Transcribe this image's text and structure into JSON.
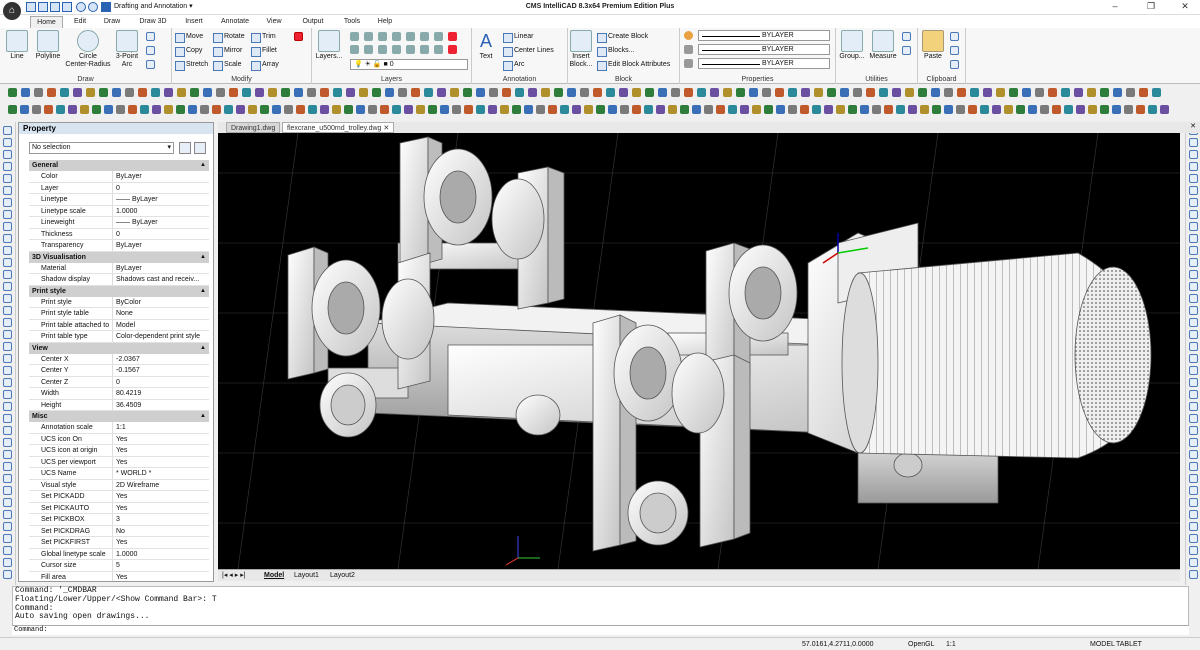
{
  "app": {
    "title": "CMS IntelliCAD 8.3x64 Premium Edition Plus",
    "workspace": "Drafting and Annotation"
  },
  "ribbon_tabs": [
    "Home",
    "Edit",
    "Draw",
    "Draw 3D",
    "Insert",
    "Annotate",
    "View",
    "Output",
    "Tools",
    "Help"
  ],
  "ribbon": {
    "draw": {
      "label": "Draw",
      "line": "Line",
      "polyline": "Polyline",
      "circle": "Circle",
      "circle_sub": "Center-Radius",
      "arc": "3-Point",
      "arc_sub": "Arc"
    },
    "modify": {
      "label": "Modify",
      "move": "Move",
      "rotate": "Rotate",
      "trim": "Trim",
      "copy": "Copy",
      "mirror": "Mirror",
      "fillet": "Fillet",
      "stretch": "Stretch",
      "scale": "Scale",
      "array": "Array"
    },
    "layers": {
      "label": "Layers",
      "button": "Layers...",
      "current": "0"
    },
    "annotation": {
      "label": "Annotation",
      "text": "Text",
      "linear": "Linear",
      "centerlines": "Center Lines",
      "arc": "Arc"
    },
    "block": {
      "label": "Block",
      "insert": "Insert",
      "insert_sub": "Block...",
      "create": "Create Block",
      "blocks": "Blocks...",
      "edit_attr": "Edit Block Attributes"
    },
    "properties": {
      "label": "Properties",
      "color": "BYLAYER",
      "linetype": "BYLAYER",
      "lineweight": "BYLAYER"
    },
    "utilities": {
      "label": "Utilities",
      "group": "Group...",
      "measure": "Measure"
    },
    "clipboard": {
      "label": "Clipboard",
      "paste": "Paste"
    }
  },
  "doc_tabs": [
    "Drawing1.dwg",
    "flexcrane_u500md_trolley.dwg"
  ],
  "property": {
    "title": "Property",
    "selection": "No selection",
    "sections": [
      {
        "name": "General",
        "rows": [
          [
            "Color",
            "ByLayer"
          ],
          [
            "Layer",
            "0"
          ],
          [
            "Linetype",
            "—— ByLayer"
          ],
          [
            "Linetype scale",
            "1.0000"
          ],
          [
            "Lineweight",
            "—— ByLayer"
          ],
          [
            "Thickness",
            "0"
          ],
          [
            "Transparency",
            "ByLayer"
          ]
        ]
      },
      {
        "name": "3D Visualisation",
        "rows": [
          [
            "Material",
            "ByLayer"
          ],
          [
            "Shadow display",
            "Shadows cast and receiv..."
          ]
        ]
      },
      {
        "name": "Print style",
        "rows": [
          [
            "Print style",
            "ByColor"
          ],
          [
            "Print style table",
            "None"
          ],
          [
            "Print table attached to",
            "Model"
          ],
          [
            "Print table type",
            "Color-dependent print style"
          ]
        ]
      },
      {
        "name": "View",
        "rows": [
          [
            "Center X",
            "-2.0367"
          ],
          [
            "Center Y",
            "-0.1567"
          ],
          [
            "Center Z",
            "0"
          ],
          [
            "Width",
            "80.4219"
          ],
          [
            "Height",
            "36.4509"
          ]
        ]
      },
      {
        "name": "Misc",
        "rows": [
          [
            "Annotation scale",
            "1:1"
          ],
          [
            "UCS icon On",
            "Yes"
          ],
          [
            "UCS icon at origin",
            "Yes"
          ],
          [
            "UCS per viewport",
            "Yes"
          ],
          [
            "UCS Name",
            "* WORLD *"
          ],
          [
            "Visual style",
            "2D Wireframe"
          ],
          [
            "Set PICKADD",
            "Yes"
          ],
          [
            "Set PICKAUTO",
            "Yes"
          ],
          [
            "Set PICKBOX",
            "3"
          ],
          [
            "Set PICKDRAG",
            "No"
          ],
          [
            "Set PICKFIRST",
            "Yes"
          ],
          [
            "Global linetype scale",
            "1.0000"
          ],
          [
            "Cursor size",
            "5"
          ],
          [
            "Fill area",
            "Yes"
          ]
        ]
      }
    ]
  },
  "layout_tabs": [
    "Model",
    "Layout1",
    "Layout2"
  ],
  "command": {
    "lines": [
      "Command: '_CMDBAR",
      "Floating/Lower/Upper/<Show Command Bar>: T",
      "Command:",
      "Auto saving open drawings..."
    ],
    "prompt": "Command:"
  },
  "status": {
    "coords": "57.0161,4.2711,0.0000",
    "renderer": "OpenGL",
    "scale": "1:1",
    "model": "MODEL",
    "tablet": "TABLET"
  }
}
